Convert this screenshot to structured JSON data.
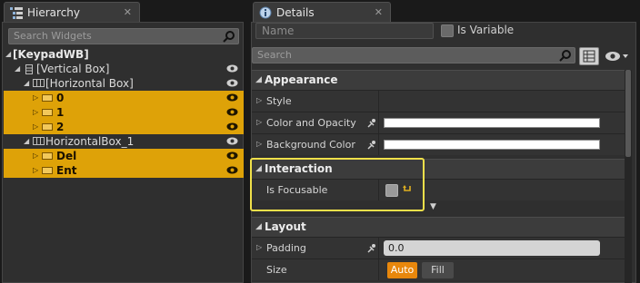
{
  "hierarchy": {
    "tab_label": "Hierarchy",
    "close_glyph": "✕",
    "search_placeholder": "Search Widgets",
    "tree": [
      {
        "label": "[KeypadWB]",
        "icon": "none",
        "arrow": "▲",
        "selected": false,
        "root": true
      },
      {
        "label": "[Vertical Box]",
        "icon": "vertical-box-icon",
        "arrow": "▲",
        "selected": false
      },
      {
        "label": "[Horizontal Box]",
        "icon": "horizontal-box-icon",
        "arrow": "▲",
        "selected": false
      },
      {
        "label": "0",
        "icon": "button-icon",
        "arrow": "▷",
        "selected": true
      },
      {
        "label": "1",
        "icon": "button-icon",
        "arrow": "▷",
        "selected": true
      },
      {
        "label": "2",
        "icon": "button-icon",
        "arrow": "▷",
        "selected": true
      },
      {
        "label": "HorizontalBox_1",
        "icon": "horizontal-box-icon",
        "arrow": "▲",
        "selected": false
      },
      {
        "label": "Del",
        "icon": "button-icon",
        "arrow": "▷",
        "selected": true
      },
      {
        "label": "Ent",
        "icon": "button-icon",
        "arrow": "▷",
        "selected": true
      }
    ]
  },
  "details": {
    "tab_label": "Details",
    "close_glyph": "✕",
    "name_placeholder": "Name",
    "is_variable_label": "Is Variable",
    "search_placeholder": "Search",
    "more_glyph": "▼",
    "sections": {
      "appearance": {
        "title": "Appearance",
        "rows": [
          {
            "label": "Style"
          },
          {
            "label": "Color and Opacity"
          },
          {
            "label": "Background Color"
          }
        ]
      },
      "interaction": {
        "title": "Interaction",
        "rows": [
          {
            "label": "Is Focusable"
          }
        ]
      },
      "layout": {
        "title": "Layout",
        "rows": [
          {
            "label": "Padding",
            "value": "0.0"
          },
          {
            "label": "Size",
            "options": [
              "Auto",
              "Fill"
            ],
            "selected": "Auto"
          }
        ]
      }
    }
  },
  "colors": {
    "selection": "#dea208",
    "highlight_box": "#f0e04a",
    "size_auto_active": "#e8870c"
  }
}
